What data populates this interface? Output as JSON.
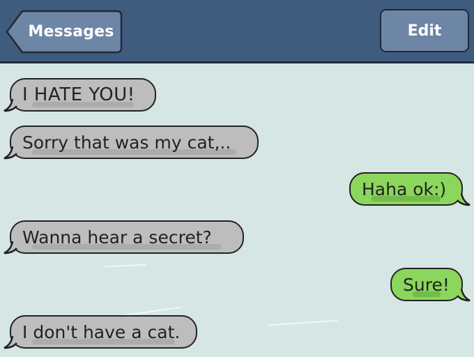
{
  "navbar": {
    "back_label": "Messages",
    "edit_label": "Edit"
  },
  "colors": {
    "navbar": "#3f5b7e",
    "button": "#6e86a6",
    "background": "#d6e6e4",
    "incoming": "#bdbdbd",
    "outgoing": "#8bd65c"
  },
  "messages": [
    {
      "direction": "incoming",
      "text": "I HATE YOU!"
    },
    {
      "direction": "incoming",
      "text": "Sorry that was my cat,.."
    },
    {
      "direction": "outgoing",
      "text": "Haha ok:)"
    },
    {
      "direction": "incoming",
      "text": "Wanna hear a secret?"
    },
    {
      "direction": "outgoing",
      "text": "Sure!"
    },
    {
      "direction": "incoming",
      "text": "I don't have a cat."
    }
  ]
}
